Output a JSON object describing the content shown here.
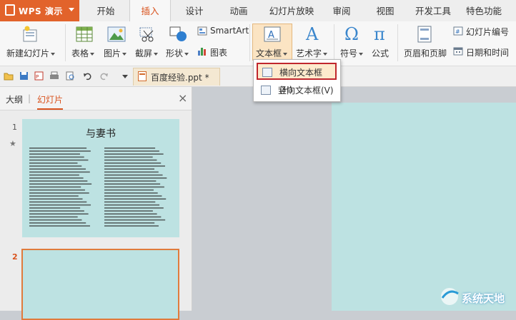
{
  "app": {
    "logo_text": "WPS 演示"
  },
  "tabs": [
    {
      "label": "开始"
    },
    {
      "label": "插入"
    },
    {
      "label": "设计"
    },
    {
      "label": "动画"
    },
    {
      "label": "幻灯片放映"
    },
    {
      "label": "审阅"
    },
    {
      "label": "视图"
    },
    {
      "label": "开发工具"
    },
    {
      "label": "特色功能"
    }
  ],
  "active_tab": "插入",
  "ribbon": {
    "new_slide": "新建幻灯片",
    "table": "表格",
    "picture": "图片",
    "screenshot": "截屏",
    "shapes": "形状",
    "smartart": "SmartArt",
    "chart": "图表",
    "textbox": "文本框",
    "wordart": "艺术字",
    "symbol": "符号",
    "equation": "公式",
    "header_footer": "页眉和页脚",
    "slide_number": "幻灯片编号",
    "date_time": "日期和时间"
  },
  "textbox_menu": {
    "horizontal": "横向文本框(H)",
    "vertical": "竖向文本框(V)"
  },
  "document_tab": "百度经验.ppt *",
  "panel": {
    "outline_tab": "大纲",
    "slides_tab": "幻灯片",
    "close": "×"
  },
  "slides": [
    {
      "number": "1",
      "title": "与妻书"
    },
    {
      "number": "2",
      "title": ""
    }
  ],
  "watermark": "系统天地",
  "colors": {
    "accent": "#d9531e",
    "logo_bg": "#e2632b",
    "slide_bg": "#bde2e2",
    "menu_highlight": "#c0262d"
  }
}
